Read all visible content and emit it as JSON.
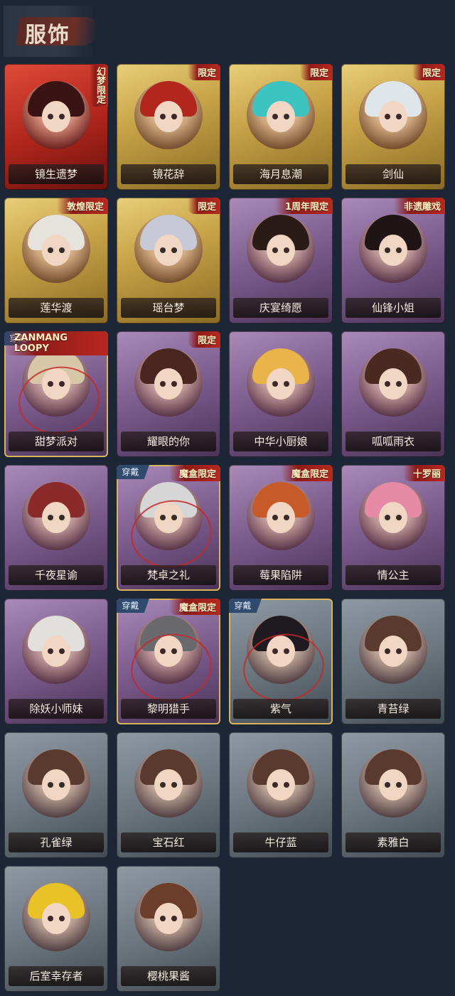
{
  "header": {
    "title": "服饰"
  },
  "items": [
    {
      "name": "镜生遗梦",
      "frame": "red",
      "badge": "幻梦限定",
      "badge_vertical": true,
      "worn": "",
      "hair": "#3a1414"
    },
    {
      "name": "镜花辞",
      "frame": "gold",
      "badge": "限定",
      "badge_vertical": false,
      "worn": "",
      "hair": "#b3261c"
    },
    {
      "name": "海月息潮",
      "frame": "gold",
      "badge": "限定",
      "badge_vertical": false,
      "worn": "",
      "hair": "#3cc4c0"
    },
    {
      "name": "剑仙",
      "frame": "gold",
      "badge": "限定",
      "badge_vertical": false,
      "worn": "",
      "hair": "#dfe6ea"
    },
    {
      "name": "莲华渡",
      "frame": "gold",
      "badge": "敦煌限定",
      "badge_vertical": false,
      "worn": "",
      "hair": "#e6e2dc"
    },
    {
      "name": "瑶台梦",
      "frame": "gold",
      "badge": "限定",
      "badge_vertical": false,
      "worn": "",
      "hair": "#c7c9d6"
    },
    {
      "name": "庆宴绮愿",
      "frame": "purple",
      "badge": "1周年限定",
      "badge_vertical": false,
      "worn": "",
      "hair": "#2b1b16"
    },
    {
      "name": "仙锋小姐",
      "frame": "purple",
      "badge": "非遗雕戏",
      "badge_vertical": false,
      "worn": "",
      "hair": "#1f1416"
    },
    {
      "name": "甜梦派对",
      "frame": "purple",
      "badge": "ZANMANG LOOPY",
      "badge_vertical": false,
      "worn": "穿戴",
      "hair": "#d8c6a8"
    },
    {
      "name": "耀眼的你",
      "frame": "purple",
      "badge": "限定",
      "badge_vertical": false,
      "worn": "",
      "hair": "#4a2620"
    },
    {
      "name": "中华小厨娘",
      "frame": "purple",
      "badge": "",
      "badge_vertical": false,
      "worn": "",
      "hair": "#e9b54a"
    },
    {
      "name": "呱呱雨衣",
      "frame": "purple",
      "badge": "",
      "badge_vertical": false,
      "worn": "",
      "hair": "#4a2a20"
    },
    {
      "name": "千夜星谕",
      "frame": "purple",
      "badge": "",
      "badge_vertical": false,
      "worn": "",
      "hair": "#8b2a2a"
    },
    {
      "name": "梵卓之礼",
      "frame": "purple",
      "badge": "魔盒限定",
      "badge_vertical": false,
      "worn": "穿戴",
      "hair": "#d6d6d6"
    },
    {
      "name": "莓果陷阱",
      "frame": "purple",
      "badge": "魔盒限定",
      "badge_vertical": false,
      "worn": "",
      "hair": "#c85a2a"
    },
    {
      "name": "情公主",
      "frame": "purple",
      "badge": "十罗丽",
      "badge_vertical": false,
      "worn": "",
      "hair": "#e68aa6"
    },
    {
      "name": "除妖小师妹",
      "frame": "purple",
      "badge": "",
      "badge_vertical": false,
      "worn": "",
      "hair": "#e2e0dc"
    },
    {
      "name": "黎明猎手",
      "frame": "purple",
      "badge": "魔盒限定",
      "badge_vertical": false,
      "worn": "穿戴",
      "hair": "#6a6a6e"
    },
    {
      "name": "紫气",
      "frame": "grey",
      "badge": "",
      "badge_vertical": false,
      "worn": "穿戴",
      "hair": "#1e1a20"
    },
    {
      "name": "青苔绿",
      "frame": "grey",
      "badge": "",
      "badge_vertical": false,
      "worn": "",
      "hair": "#5a3a2e"
    },
    {
      "name": "孔雀绿",
      "frame": "grey",
      "badge": "",
      "badge_vertical": false,
      "worn": "",
      "hair": "#5a3a2e"
    },
    {
      "name": "宝石红",
      "frame": "grey",
      "badge": "",
      "badge_vertical": false,
      "worn": "",
      "hair": "#5a3a2e"
    },
    {
      "name": "牛仔蓝",
      "frame": "grey",
      "badge": "",
      "badge_vertical": false,
      "worn": "",
      "hair": "#5a3a2e"
    },
    {
      "name": "素雅白",
      "frame": "grey",
      "badge": "",
      "badge_vertical": false,
      "worn": "",
      "hair": "#5a3a2e"
    },
    {
      "name": "后室幸存者",
      "frame": "grey",
      "badge": "",
      "badge_vertical": false,
      "worn": "",
      "hair": "#e9c227"
    },
    {
      "name": "樱桃果酱",
      "frame": "grey",
      "badge": "",
      "badge_vertical": false,
      "worn": "",
      "hair": "#6a3e2a"
    }
  ]
}
